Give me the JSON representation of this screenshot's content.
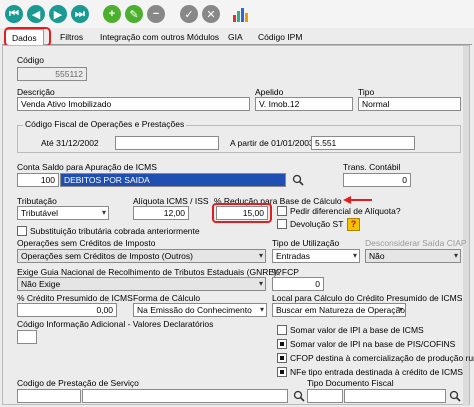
{
  "toolbar": {
    "icons": [
      "first-icon",
      "previous-icon",
      "next-icon",
      "last-icon",
      "add-icon",
      "edit-icon",
      "confirm-icon",
      "cancel-icon",
      "report-icon"
    ]
  },
  "tabs": [
    "Dados",
    "Filtros",
    "Integração com outros Módulos",
    "GIA",
    "Código IPM"
  ],
  "form": {
    "codigo_label": "Código",
    "codigo_value": "555112",
    "descricao_label": "Descrição",
    "descricao_value": "Venda Ativo Imobilizado",
    "apelido_label": "Apelido",
    "apelido_value": "V. Imob.12",
    "tipo_label": "Tipo",
    "tipo_value": "Normal",
    "cfop_group_label": "Código Fiscal de Operações e Prestações",
    "ate_label": "Até 31/12/2002",
    "ate_value": "",
    "apartir_label": "A partir de 01/01/2003",
    "apartir_value": "5.551",
    "conta_label": "Conta Saldo para Apuração de ICMS",
    "conta_code": "100",
    "conta_desc": "DEBITOS POR SAIDA",
    "trans_label": "Trans. Contábil",
    "trans_value": "0",
    "tributacao_label": "Tributação",
    "tributacao_value": "Tributável",
    "aliquota_label": "Alíquota ICMS / ISS",
    "aliquota_value": "12,00",
    "reducao_label": "% Redução para Base de Cálculo",
    "reducao_value": "15,00",
    "pedir_label": "Pedir diferencial de Alíquota?",
    "devolucao_label": "Devolução ST",
    "substituicao_label": "Substituição tributária cobrada anteriormente",
    "opsem_label": "Operações sem Créditos de Imposto",
    "opsem_value": "Operações sem Créditos de Imposto (Outros)",
    "tipo_util_label": "Tipo de Utilização",
    "tipo_util_value": "Entradas",
    "desconsiderar_label": "Desconsiderar Saída CIAP",
    "desconsiderar_value": "Não",
    "gnre_label": "Exige Guia Nacional de Recolhimento de Tributos Estaduais (GNRE)?",
    "gnre_value": "Não Exige",
    "fcp_label": "% FCP",
    "fcp_value": "0",
    "credito_label": "% Crédito Presumido de ICMS",
    "credito_value": "0,00",
    "forma_label": "Forma de Cálculo",
    "forma_value": "Na Emissão do Conhecimento",
    "local_label": "Local para Cálculo do Crédito Presumido de ICMS",
    "local_value": "Buscar em Natureza de Operação",
    "cod_info_label": "Código Informação Adicional - Valores Declaratórios",
    "somar_ipi_label": "Somar valor de IPI a base de ICMS",
    "somar_pis_label": "Somar valor de IPI na base de PIS/COFINS",
    "cfop_rural_label": "CFOP destina à comercialização de produção rural",
    "nfe_label": "NFe tipo entrada destinada à crédito de ICMS",
    "cod_prest_label": "Codigo de Prestação de Serviço",
    "tipo_doc_label": "Tipo Documento Fiscal"
  }
}
